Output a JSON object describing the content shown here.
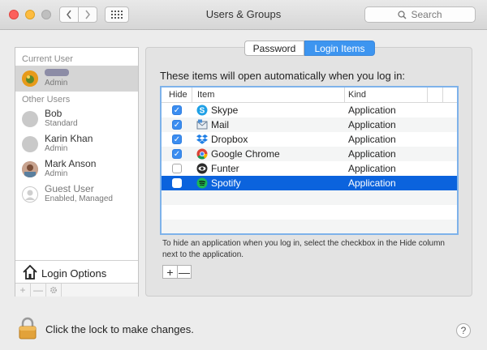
{
  "window": {
    "title": "Users & Groups",
    "search_placeholder": "Search"
  },
  "sidebar": {
    "current_user_header": "Current User",
    "current_user_role": "Admin",
    "other_users_header": "Other Users",
    "users": [
      {
        "name": "Bob",
        "role": "Standard"
      },
      {
        "name": "Karin Khan",
        "role": "Admin"
      },
      {
        "name": "Mark Anson",
        "role": "Admin"
      },
      {
        "name": "Guest User",
        "role": "Enabled, Managed"
      }
    ],
    "login_options_label": "Login Options",
    "add_label": "+",
    "remove_label": "—",
    "gear_icon": "gear-icon"
  },
  "tabs": [
    {
      "label": "Password",
      "active": false
    },
    {
      "label": "Login Items",
      "active": true
    }
  ],
  "login_items": {
    "intro": "These items will open automatically when you log in:",
    "columns": {
      "hide": "Hide",
      "item": "Item",
      "kind": "Kind"
    },
    "rows": [
      {
        "hide": true,
        "name": "Skype",
        "kind": "Application",
        "icon": "skype-icon"
      },
      {
        "hide": true,
        "name": "Mail",
        "kind": "Application",
        "icon": "mail-icon"
      },
      {
        "hide": true,
        "name": "Dropbox",
        "kind": "Application",
        "icon": "dropbox-icon"
      },
      {
        "hide": true,
        "name": "Google Chrome",
        "kind": "Application",
        "icon": "chrome-icon"
      },
      {
        "hide": false,
        "name": "Funter",
        "kind": "Application",
        "icon": "funter-icon"
      },
      {
        "hide": false,
        "name": "Spotify",
        "kind": "Application",
        "icon": "spotify-icon",
        "selected": true
      }
    ],
    "hint": "To hide an application when you log in, select the checkbox in the Hide column next to the application.",
    "add_label": "+",
    "remove_label": "—"
  },
  "footer": {
    "lock_label": "Click the lock to make changes.",
    "help_label": "?"
  },
  "colors": {
    "selection": "#0b63dd",
    "tab_active": "#3d95f0",
    "checkbox": "#3b8df0"
  }
}
